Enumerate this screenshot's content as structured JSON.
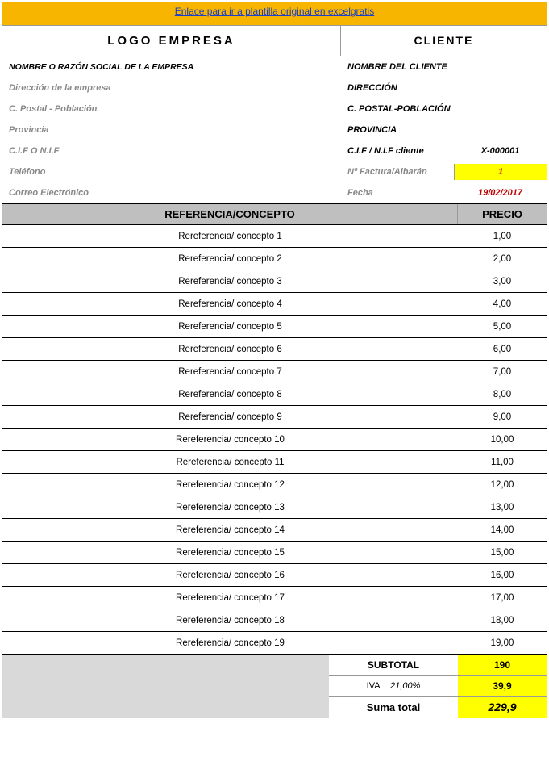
{
  "link_text": "Enlace para ir a plantilla original en excelgratis",
  "header": {
    "logo_label": "LOGO  EMPRESA",
    "client_label": "CLIENTE"
  },
  "company": {
    "name_label": "NOMBRE O RAZÓN SOCIAL DE LA EMPRESA",
    "address_label": "Dirección de la empresa",
    "postal_label": "C. Postal - Población",
    "province_label": "Provincia",
    "cif_label": "C.I.F O N.I.F",
    "phone_label": "Teléfono",
    "email_label": "Correo Electrónico"
  },
  "client": {
    "name_label": "NOMBRE DEL CLIENTE",
    "address_label": "DIRECCIÓN",
    "postal_label": "C. POSTAL-POBLACIÓN",
    "province_label": "PROVINCIA",
    "cif_label": "C.I.F / N.I.F cliente",
    "cif_value": "X-000001",
    "invoice_label": "Nº Factura/Albarán",
    "invoice_value": "1",
    "date_label": "Fecha",
    "date_value": "19/02/2017"
  },
  "columns": {
    "concept": "REFERENCIA/CONCEPTO",
    "price": "PRECIO"
  },
  "items": [
    {
      "concept": "Rereferencia/ concepto 1",
      "price": "1,00"
    },
    {
      "concept": "Rereferencia/ concepto 2",
      "price": "2,00"
    },
    {
      "concept": "Rereferencia/ concepto 3",
      "price": "3,00"
    },
    {
      "concept": "Rereferencia/ concepto 4",
      "price": "4,00"
    },
    {
      "concept": "Rereferencia/ concepto 5",
      "price": "5,00"
    },
    {
      "concept": "Rereferencia/ concepto 6",
      "price": "6,00"
    },
    {
      "concept": "Rereferencia/ concepto 7",
      "price": "7,00"
    },
    {
      "concept": "Rereferencia/ concepto 8",
      "price": "8,00"
    },
    {
      "concept": "Rereferencia/ concepto 9",
      "price": "9,00"
    },
    {
      "concept": "Rereferencia/ concepto 10",
      "price": "10,00"
    },
    {
      "concept": "Rereferencia/ concepto 11",
      "price": "11,00"
    },
    {
      "concept": "Rereferencia/ concepto 12",
      "price": "12,00"
    },
    {
      "concept": "Rereferencia/ concepto 13",
      "price": "13,00"
    },
    {
      "concept": "Rereferencia/ concepto 14",
      "price": "14,00"
    },
    {
      "concept": "Rereferencia/ concepto 15",
      "price": "15,00"
    },
    {
      "concept": "Rereferencia/ concepto 16",
      "price": "16,00"
    },
    {
      "concept": "Rereferencia/ concepto 17",
      "price": "17,00"
    },
    {
      "concept": "Rereferencia/ concepto 18",
      "price": "18,00"
    },
    {
      "concept": "Rereferencia/ concepto 19",
      "price": "19,00"
    }
  ],
  "totals": {
    "subtotal_label": "SUBTOTAL",
    "subtotal_value": "190",
    "iva_label": "IVA",
    "iva_pct": "21,00%",
    "iva_value": "39,9",
    "sum_label": "Suma total",
    "sum_value": "229,9"
  }
}
